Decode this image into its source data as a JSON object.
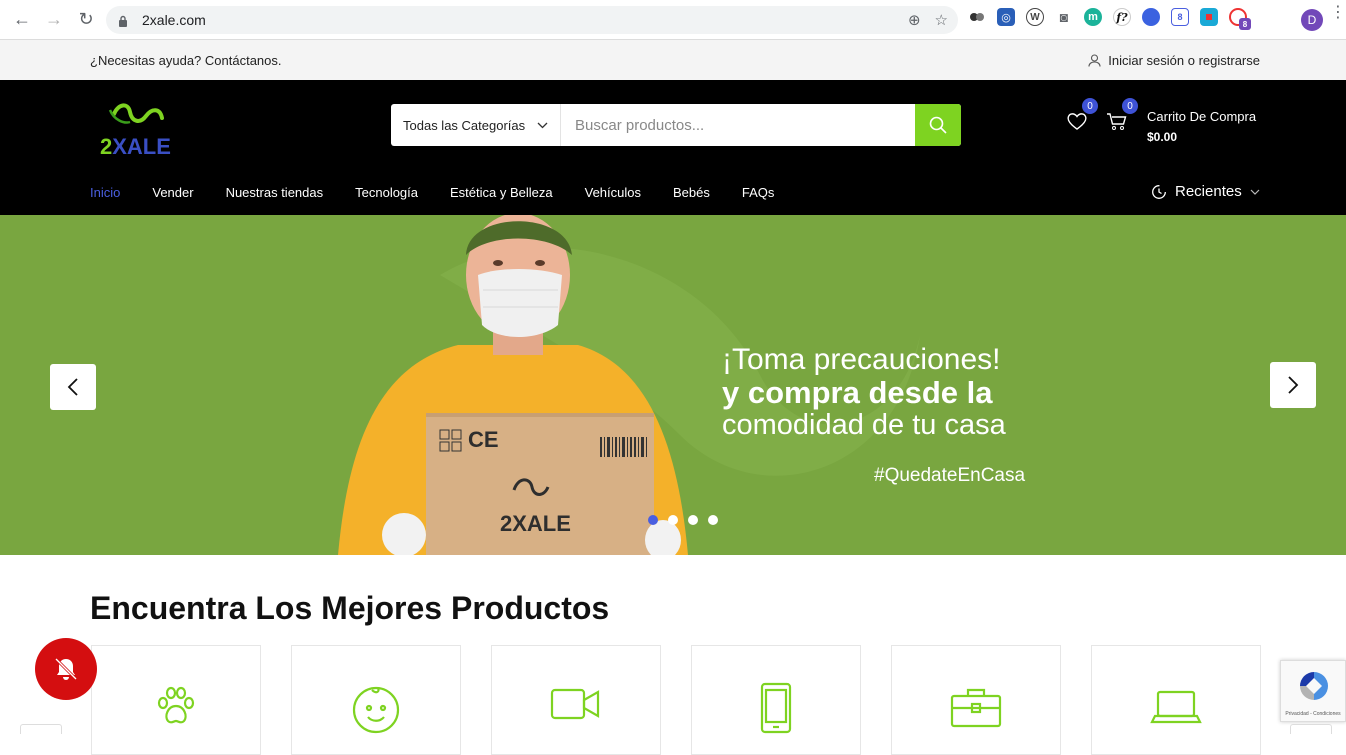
{
  "browser": {
    "url": "2xale.com",
    "profile_initial": "D",
    "extension_badge": "8"
  },
  "topbar": {
    "help_text": "¿Necesitas ayuda? Contáctanos.",
    "login_text": "Iniciar sesión o registrarse"
  },
  "header": {
    "logo_text": "2XALE",
    "search": {
      "category": "Todas las Categorías",
      "placeholder": "Buscar productos..."
    },
    "wishlist_count": "0",
    "cart_count": "0",
    "cart_label": "Carrito De Compra",
    "cart_total": "$0.00",
    "nav": [
      {
        "label": "Inicio",
        "active": true
      },
      {
        "label": "Vender"
      },
      {
        "label": "Nuestras tiendas"
      },
      {
        "label": "Tecnología"
      },
      {
        "label": "Estética y Belleza"
      },
      {
        "label": "Vehículos"
      },
      {
        "label": "Bebés"
      },
      {
        "label": "FAQs"
      }
    ],
    "recent_label": "Recientes"
  },
  "hero": {
    "line1": "¡Toma precauciones!",
    "line2": "y compra desde la",
    "line3": "comodidad de tu casa",
    "hashtag": "#QuedateEnCasa",
    "box_brand": "2XALE",
    "box_mark": "CE",
    "slide_count": 4,
    "active_slide": 1
  },
  "products": {
    "title": "Encuentra Los Mejores Productos",
    "categories": [
      {
        "icon": "paw-icon"
      },
      {
        "icon": "baby-face-icon"
      },
      {
        "icon": "video-camera-icon"
      },
      {
        "icon": "smartphone-icon"
      },
      {
        "icon": "briefcase-icon"
      },
      {
        "icon": "laptop-icon"
      }
    ]
  },
  "recaptcha": {
    "text": "Privacidad - Condiciones"
  },
  "colors": {
    "accent_green": "#7ed321",
    "hero_green": "#79a640",
    "accent_blue": "#3e52d6",
    "bell_red": "#d40e10"
  }
}
